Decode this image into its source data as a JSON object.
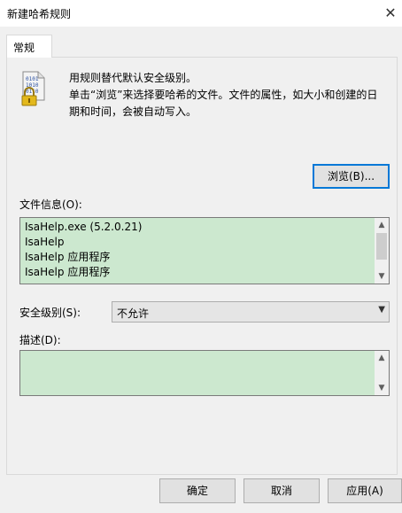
{
  "window": {
    "title": "新建哈希规则",
    "close_glyph": "✕"
  },
  "tabs": [
    {
      "label": "常规"
    }
  ],
  "general": {
    "icon": "binary-file-lock-icon",
    "description_line1": "用规则替代默认安全级别。",
    "description_line2": "单击“浏览”来选择要哈希的文件。文件的属性，如大小和创建的日期和时间，会被自动写入。",
    "browse_label": "浏览(B)...",
    "file_info_label": "文件信息(O):",
    "file_info_lines": [
      "IsaHelp.exe (5.2.0.21)",
      "IsaHelp",
      "IsaHelp 应用程序",
      "IsaHelp 应用程序"
    ],
    "security_level_label": "安全级别(S):",
    "security_level_value": "不允许",
    "description_label": "描述(D):",
    "description_value": ""
  },
  "buttons": {
    "ok": "确定",
    "cancel": "取消",
    "apply": "应用(A)"
  },
  "colors": {
    "field_background": "#cce8cf",
    "focus_border": "#0078d7"
  }
}
